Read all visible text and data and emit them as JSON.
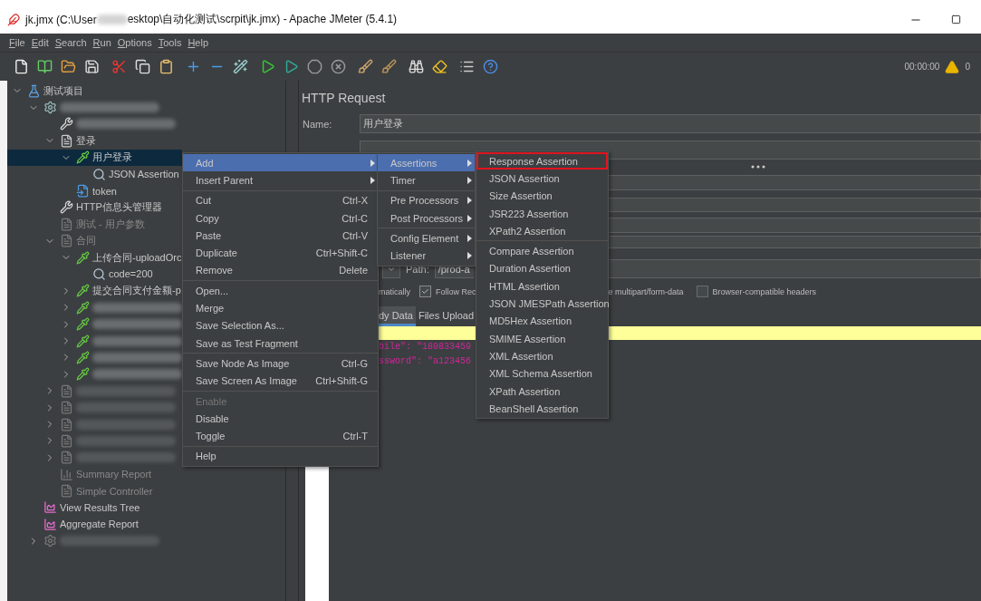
{
  "window": {
    "title_start": "jk.jmx (C:\\User",
    "title_end": "esktop\\自动化测试\\scrpit\\jk.jmx) - Apache JMeter (5.4.1)"
  },
  "menu_bar": [
    "File",
    "Edit",
    "Search",
    "Run",
    "Options",
    "Tools",
    "Help"
  ],
  "toolbar": {
    "timer": "00:00:00",
    "warnings": "0"
  },
  "tree": [
    {
      "label": "测试项目",
      "kind": "flask",
      "expanded": true,
      "selected": false,
      "disabled": false,
      "children": [
        {
          "redacted": true,
          "kind": "gear",
          "expanded": true,
          "selected": false,
          "disabled": false,
          "children": [
            {
              "redacted": true,
              "kind": "tools",
              "selected": false,
              "disabled": false
            },
            {
              "label": "登录",
              "kind": "controller",
              "expanded": true,
              "selected": false,
              "disabled": false,
              "children": [
                {
                  "label": "用户登录",
                  "kind": "sampler",
                  "expanded": true,
                  "selected": true,
                  "disabled": false,
                  "children": [
                    {
                      "label": "JSON Assertion",
                      "kind": "assertion",
                      "selected": false,
                      "disabled": false
                    }
                  ]
                },
                {
                  "label": "token",
                  "kind": "extractor",
                  "selected": false,
                  "disabled": false
                }
              ]
            },
            {
              "label": "HTTP信息头管理器",
              "kind": "tools",
              "selected": false,
              "disabled": false
            },
            {
              "label": "测试 - 用户参数",
              "kind": "document",
              "selected": false,
              "disabled": true
            },
            {
              "label": "合同",
              "kind": "controller",
              "expanded": true,
              "selected": false,
              "disabled": true,
              "children": [
                {
                  "label": "上传合同-uploadOrc",
                  "kind": "sampler",
                  "expanded": true,
                  "selected": false,
                  "disabled": false,
                  "children": [
                    {
                      "label": "code=200",
                      "kind": "assertion",
                      "selected": false,
                      "disabled": false
                    }
                  ]
                },
                {
                  "label": "提交合同支付金额-p",
                  "kind": "sampler",
                  "expanded": false,
                  "selected": false,
                  "disabled": false
                },
                {
                  "redacted": true,
                  "kind": "sampler",
                  "expanded": false,
                  "selected": false,
                  "disabled": false
                },
                {
                  "redacted": true,
                  "kind": "sampler",
                  "expanded": false,
                  "selected": false,
                  "disabled": false
                },
                {
                  "redacted": true,
                  "kind": "sampler",
                  "expanded": false,
                  "selected": false,
                  "disabled": false
                },
                {
                  "redacted": true,
                  "kind": "sampler",
                  "expanded": false,
                  "selected": false,
                  "disabled": false
                },
                {
                  "redacted": true,
                  "kind": "sampler",
                  "expanded": false,
                  "selected": false,
                  "disabled": false
                }
              ]
            },
            {
              "redacted": true,
              "kind": "controller",
              "expanded": false,
              "selected": false,
              "disabled": true
            },
            {
              "redacted": true,
              "kind": "controller",
              "expanded": false,
              "selected": false,
              "disabled": true
            },
            {
              "redacted": true,
              "kind": "controller",
              "expanded": false,
              "selected": false,
              "disabled": true
            },
            {
              "redacted": true,
              "kind": "controller",
              "expanded": false,
              "selected": false,
              "disabled": true
            },
            {
              "redacted": true,
              "kind": "controller",
              "expanded": false,
              "selected": false,
              "disabled": true
            },
            {
              "label": "Summary Report",
              "kind": "report",
              "selected": false,
              "disabled": true
            },
            {
              "label": "Simple Controller",
              "kind": "controller",
              "selected": false,
              "disabled": true
            }
          ]
        },
        {
          "label": "View Results Tree",
          "kind": "results",
          "selected": false,
          "disabled": false
        },
        {
          "label": "Aggregate Report",
          "kind": "results",
          "selected": false,
          "disabled": false
        },
        {
          "redacted": true,
          "kind": "gear",
          "expanded": false,
          "selected": false,
          "disabled": true
        }
      ]
    }
  ],
  "http_request": {
    "title": "HTTP Request",
    "name_label": "Name:",
    "name_value": "用户登录",
    "path_label": "Path:",
    "path_value": "/prod-a",
    "options": [
      {
        "kind": "text",
        "label": "matically"
      },
      {
        "kind": "checkbox",
        "label": "Follow Rec",
        "checked": true
      },
      {
        "kind": "text",
        "label": "e multipart/form-data"
      },
      {
        "kind": "checkbox",
        "label": "Browser-compatible headers",
        "checked": false
      }
    ],
    "tabs": [
      {
        "label": "dy Data",
        "selected": true
      },
      {
        "label": "Files Upload",
        "selected": false
      }
    ],
    "body_lines": [
      "bile\": \"180833459",
      "ssword\": \"a123456"
    ]
  },
  "context_menu": {
    "groups": [
      [
        {
          "label": "Add",
          "submenu": true,
          "highlighted": true,
          "disabled": false
        },
        {
          "label": "Insert Parent",
          "submenu": true,
          "highlighted": false,
          "disabled": false
        }
      ],
      [
        {
          "label": "Cut",
          "shortcut": "Ctrl-X",
          "submenu": false,
          "highlighted": false,
          "disabled": false
        },
        {
          "label": "Copy",
          "shortcut": "Ctrl-C",
          "submenu": false,
          "highlighted": false,
          "disabled": false
        },
        {
          "label": "Paste",
          "shortcut": "Ctrl-V",
          "submenu": false,
          "highlighted": false,
          "disabled": false
        },
        {
          "label": "Duplicate",
          "shortcut": "Ctrl+Shift-C",
          "submenu": false,
          "highlighted": false,
          "disabled": false
        },
        {
          "label": "Remove",
          "shortcut": "Delete",
          "submenu": false,
          "highlighted": false,
          "disabled": false
        }
      ],
      [
        {
          "label": "Open...",
          "submenu": false,
          "highlighted": false,
          "disabled": false
        },
        {
          "label": "Merge",
          "submenu": false,
          "highlighted": false,
          "disabled": false
        },
        {
          "label": "Save Selection As...",
          "submenu": false,
          "highlighted": false,
          "disabled": false
        },
        {
          "label": "Save as Test Fragment",
          "submenu": false,
          "highlighted": false,
          "disabled": false
        }
      ],
      [
        {
          "label": "Save Node As Image",
          "shortcut": "Ctrl-G",
          "submenu": false,
          "highlighted": false,
          "disabled": false
        },
        {
          "label": "Save Screen As Image",
          "shortcut": "Ctrl+Shift-G",
          "submenu": false,
          "highlighted": false,
          "disabled": false
        }
      ],
      [
        {
          "label": "Enable",
          "submenu": false,
          "highlighted": false,
          "disabled": true
        },
        {
          "label": "Disable",
          "submenu": false,
          "highlighted": false,
          "disabled": false
        },
        {
          "label": "Toggle",
          "shortcut": "Ctrl-T",
          "submenu": false,
          "highlighted": false,
          "disabled": false
        }
      ],
      [
        {
          "label": "Help",
          "submenu": false,
          "highlighted": false,
          "disabled": false
        }
      ]
    ]
  },
  "add_menu": {
    "groups": [
      [
        {
          "label": "Assertions",
          "highlighted": true
        },
        {
          "label": "Timer",
          "highlighted": false
        }
      ],
      [
        {
          "label": "Pre Processors",
          "highlighted": false
        },
        {
          "label": "Post Processors",
          "highlighted": false
        }
      ],
      [
        {
          "label": "Config Element",
          "highlighted": false
        },
        {
          "label": "Listener",
          "highlighted": false
        }
      ]
    ]
  },
  "assertions_menu": {
    "groups": [
      [
        {
          "label": "Response Assertion",
          "marked": true
        },
        {
          "label": "JSON Assertion",
          "marked": false
        },
        {
          "label": "Size Assertion",
          "marked": false
        },
        {
          "label": "JSR223 Assertion",
          "marked": false
        },
        {
          "label": "XPath2 Assertion",
          "marked": false
        }
      ],
      [
        {
          "label": "Compare Assertion",
          "marked": false
        },
        {
          "label": "Duration Assertion",
          "marked": false
        },
        {
          "label": "HTML Assertion",
          "marked": false
        },
        {
          "label": "JSON JMESPath Assertion",
          "marked": false
        },
        {
          "label": "MD5Hex Assertion",
          "marked": false
        },
        {
          "label": "SMIME Assertion",
          "marked": false
        },
        {
          "label": "XML Assertion",
          "marked": false
        },
        {
          "label": "XML Schema Assertion",
          "marked": false
        },
        {
          "label": "XPath Assertion",
          "marked": false
        },
        {
          "label": "BeanShell Assertion",
          "marked": false
        }
      ]
    ]
  }
}
